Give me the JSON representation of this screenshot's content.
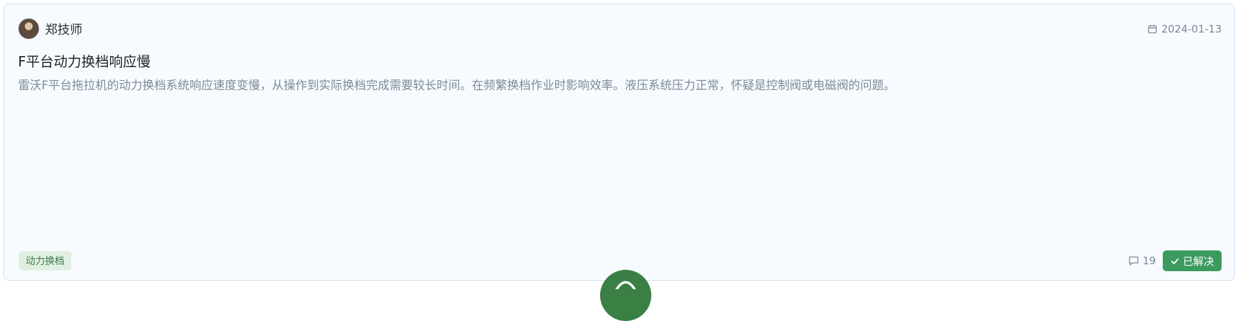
{
  "post": {
    "author": "郑技师",
    "date": "2024-01-13",
    "title": "F平台动力换档响应慢",
    "description": "雷沃F平台拖拉机的动力换档系统响应速度变慢，从操作到实际换档完成需要较长时间。在频繁换档作业时影响效率。液压系统压力正常，怀疑是控制阀或电磁阀的问题。",
    "tag": "动力换档",
    "comment_count": "19",
    "status": "已解决"
  },
  "icons": {
    "avatar": "author-avatar",
    "date": "calendar-icon",
    "comments": "comment-icon",
    "status": "check-icon",
    "fab": "chat-icon"
  },
  "colors": {
    "card_bg": "#f7fbff",
    "card_border": "#cfe1ef",
    "tag_bg": "#e0efe1",
    "tag_text": "#3c7a47",
    "resolved_bg": "#3b9b5e",
    "fab_bg": "#3a7f44"
  }
}
